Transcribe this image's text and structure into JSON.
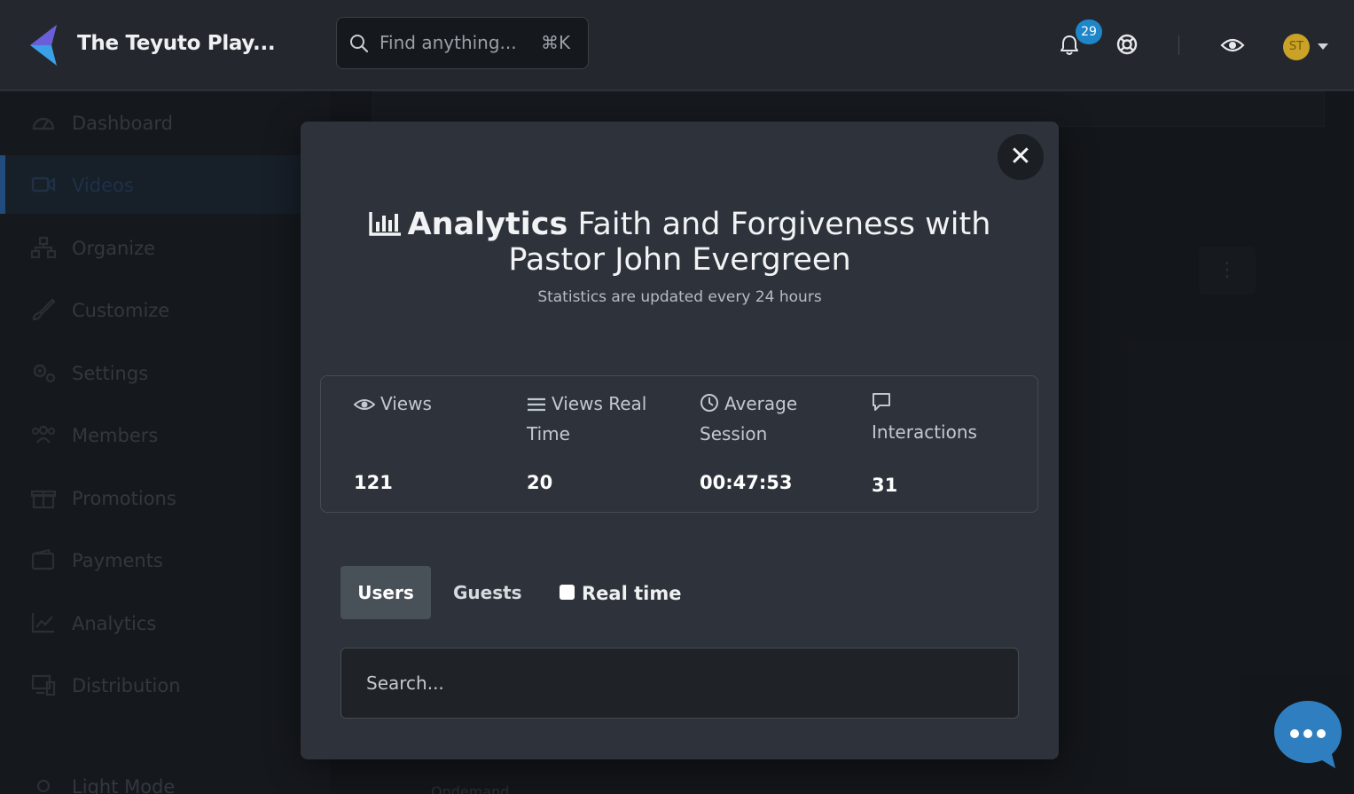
{
  "header": {
    "brand": "The Teyuto Play...",
    "search_placeholder": "Find anything...",
    "search_shortcut": "⌘K",
    "notification_count": "29",
    "avatar_initials": "ST",
    "accent_color": "#1f86c9"
  },
  "sidebar": {
    "items": [
      {
        "label": "Dashboard",
        "icon": "dashboard-icon"
      },
      {
        "label": "Videos",
        "icon": "video-icon",
        "active": true
      },
      {
        "label": "Organize",
        "icon": "organize-icon"
      },
      {
        "label": "Customize",
        "icon": "brush-icon"
      },
      {
        "label": "Settings",
        "icon": "settings-icon"
      },
      {
        "label": "Members",
        "icon": "members-icon"
      },
      {
        "label": "Promotions",
        "icon": "gift-icon"
      },
      {
        "label": "Payments",
        "icon": "wallet-icon"
      },
      {
        "label": "Analytics",
        "icon": "chart-line-icon"
      },
      {
        "label": "Distribution",
        "icon": "devices-icon"
      }
    ],
    "light_mode_label": "Light Mode"
  },
  "background": {
    "ondemand_label": "Ondemand"
  },
  "modal": {
    "title_bold": "Analytics",
    "title_rest": "Faith and Forgiveness with Pastor John Evergreen",
    "subtitle": "Statistics are updated every 24 hours",
    "stats": [
      {
        "label": "Views",
        "value": "121",
        "icon": "eye-icon"
      },
      {
        "label": "Views Real Time",
        "value": "20",
        "icon": "list-icon"
      },
      {
        "label": "Average Session",
        "value": "00:47:53",
        "icon": "clock-icon"
      },
      {
        "label": "Interactions",
        "value": "31",
        "icon": "comment-icon"
      }
    ],
    "tabs": {
      "users": "Users",
      "guests": "Guests"
    },
    "realtime_label": "Real time",
    "realtime_checked": false,
    "search_placeholder": "Search..."
  }
}
